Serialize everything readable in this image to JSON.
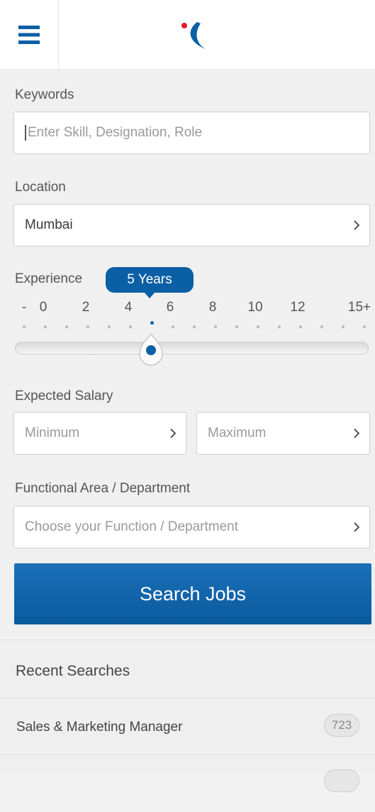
{
  "header": {
    "menu_icon": "hamburger-menu-icon",
    "logo_icon": "brand-logo-icon"
  },
  "keywords": {
    "label": "Keywords",
    "placeholder": "Enter Skill, Designation, Role"
  },
  "location": {
    "label": "Location",
    "value": "Mumbai"
  },
  "experience": {
    "label": "Experience",
    "selected_label": "5 Years",
    "selected_value": 5,
    "ticks": [
      "-",
      "0",
      "2",
      "4",
      "6",
      "8",
      "10",
      "12",
      "15+"
    ]
  },
  "salary": {
    "label": "Expected Salary",
    "min_placeholder": "Minimum",
    "max_placeholder": "Maximum"
  },
  "functional_area": {
    "label": "Functional Area / Department",
    "placeholder": "Choose your Function / Department"
  },
  "search_button": {
    "label": "Search Jobs"
  },
  "recent": {
    "title": "Recent Searches",
    "items": [
      {
        "label": "Sales & Marketing Manager",
        "count": "723"
      }
    ]
  },
  "colors": {
    "accent": "#0b5fa5",
    "logo_red": "#e21b2d"
  }
}
